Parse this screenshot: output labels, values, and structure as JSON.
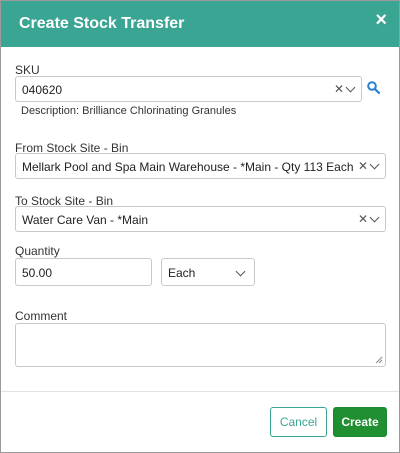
{
  "dialog": {
    "title": "Create Stock Transfer",
    "close_icon": "×"
  },
  "sku": {
    "label": "SKU",
    "value": "040620",
    "description": "Description: Brilliance Chlorinating Granules"
  },
  "from_site": {
    "label": "From Stock Site - Bin",
    "value": "Mellark Pool and Spa Main Warehouse - *Main - Qty 113 Each"
  },
  "to_site": {
    "label": "To Stock Site - Bin",
    "value": "Water Care Van - *Main"
  },
  "quantity": {
    "label": "Quantity",
    "value": "50.00",
    "unit": "Each"
  },
  "comment": {
    "label": "Comment",
    "value": ""
  },
  "buttons": {
    "cancel": "Cancel",
    "create": "Create"
  },
  "colors": {
    "header": "#3aa593",
    "create_button": "#1f8f31",
    "search_icon": "#2a7fd4"
  },
  "icons": {
    "clear": "clear-icon",
    "dropdown": "chevron-down-icon",
    "search": "search-icon",
    "close": "close-icon"
  }
}
